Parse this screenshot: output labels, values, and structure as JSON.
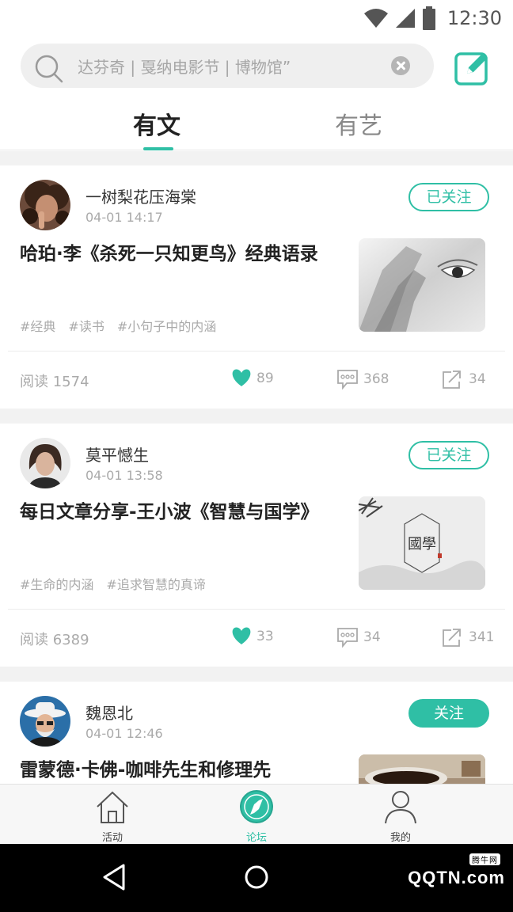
{
  "status_bar": {
    "time": "12:30"
  },
  "search": {
    "placeholder": "达芬奇 | 戛纳电影节 | 博物馆”"
  },
  "tabs": [
    {
      "label": "有文",
      "active": true
    },
    {
      "label": "有艺",
      "active": false
    }
  ],
  "posts": [
    {
      "author": "一树梨花压海棠",
      "time": "04-01 14:17",
      "follow_label": "已关注",
      "title": "哈珀·李《杀死一只知更鸟》经典语录",
      "tags": [
        "#经典",
        "#读书",
        "#小句子中的内涵"
      ],
      "read": "阅读 1574",
      "likes": "89",
      "comments": "368",
      "shares": "34"
    },
    {
      "author": "莫平憾生",
      "time": "04-01 13:58",
      "follow_label": "已关注",
      "title": "每日文章分享-王小波《智慧与国学》",
      "tags": [
        "#生命的内涵",
        "#追求智慧的真谛"
      ],
      "thumb_text": "國學",
      "read": "阅读 6389",
      "likes": "33",
      "comments": "34",
      "shares": "341"
    },
    {
      "author": "魏恩北",
      "time": "04-01 12:46",
      "follow_label": "关注",
      "title": "雷蒙德·卡佛-咖啡先生和修理先"
    }
  ],
  "bottom_nav": [
    {
      "label": "活动",
      "icon": "home-icon",
      "active": false
    },
    {
      "label": "论坛",
      "icon": "compass-icon",
      "active": true
    },
    {
      "label": "我的",
      "icon": "person-icon",
      "active": false
    }
  ],
  "watermark": {
    "brand": "QQTN.com",
    "badge": "腾牛网"
  },
  "colors": {
    "accent": "#2fbfa5",
    "like": "#2fbfa5"
  }
}
